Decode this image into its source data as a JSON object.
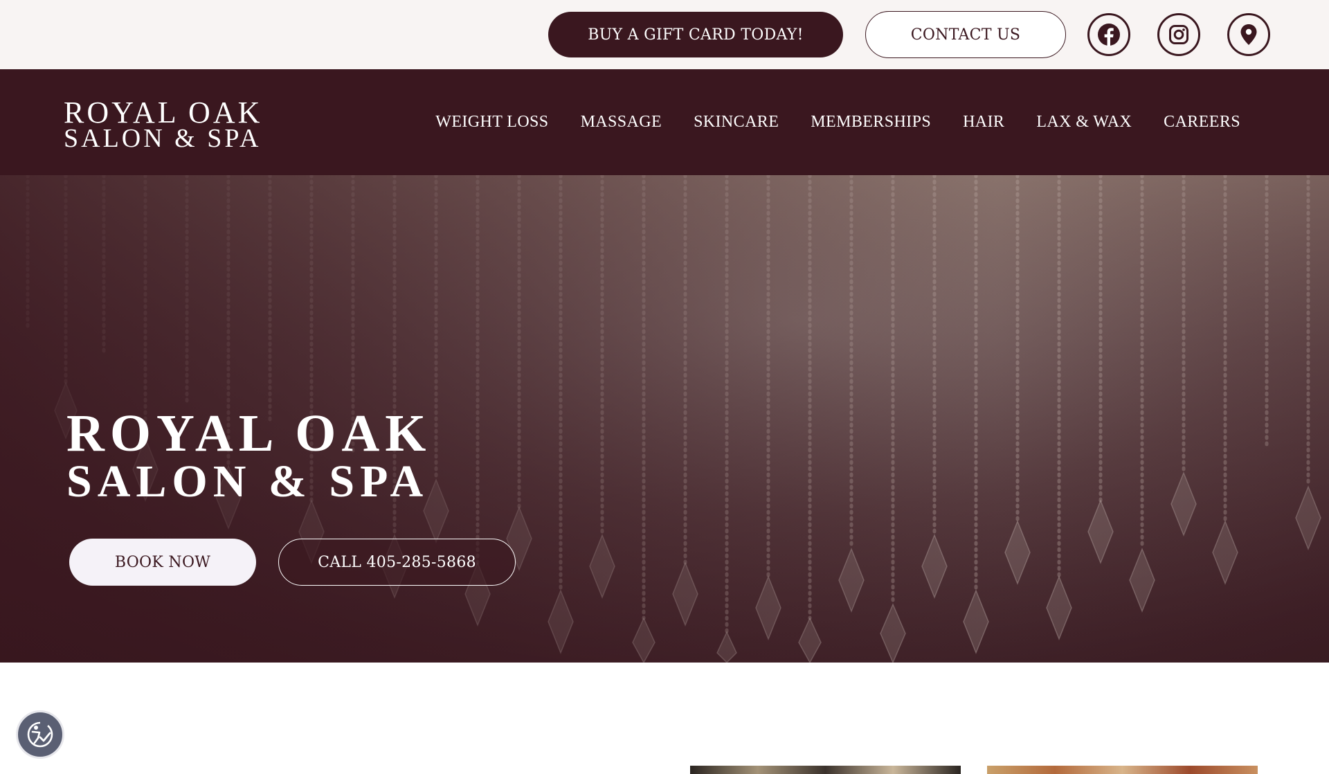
{
  "topbar": {
    "gift_card_label": "BUY A GIFT CARD TODAY!",
    "contact_label": "CONTACT US",
    "social": [
      {
        "icon": "facebook-icon"
      },
      {
        "icon": "instagram-icon"
      },
      {
        "icon": "map-pin-icon"
      }
    ]
  },
  "nav": {
    "logo_line1": "ROYAL OAK",
    "logo_line2": "SALON & SPA",
    "items": [
      {
        "label": "WEIGHT LOSS"
      },
      {
        "label": "MASSAGE"
      },
      {
        "label": "SKINCARE"
      },
      {
        "label": "MEMBERSHIPS"
      },
      {
        "label": "HAIR"
      },
      {
        "label": "LAX & WAX"
      },
      {
        "label": "CAREERS"
      }
    ]
  },
  "hero": {
    "title_line1": "ROYAL OAK",
    "title_line2": "SALON & SPA",
    "book_label": "BOOK NOW",
    "call_label": "CALL 405-285-5868",
    "background": "crystal chandelier photo"
  },
  "colors": {
    "brand": "#3a171f",
    "topbar_bg": "#f8f4f3",
    "book_button_bg": "#f5f2f8",
    "accessibility_bg": "#5a5f73"
  },
  "accessibility_widget": {
    "icon": "accessibility-icon"
  }
}
